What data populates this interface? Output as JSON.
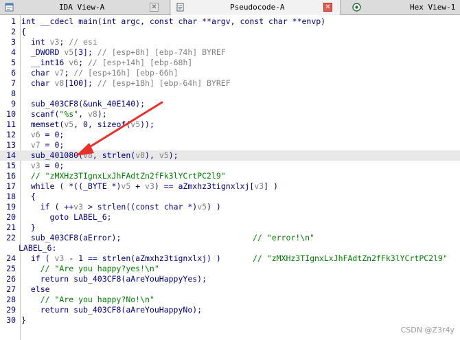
{
  "tabs": [
    {
      "label": "IDA View-A",
      "icon": "window-icon"
    },
    {
      "label": "Pseudocode-A",
      "icon": "document-icon"
    },
    {
      "label": "Hex View-1",
      "icon": "hex-icon"
    }
  ],
  "close_glyph": "✕",
  "watermark": "CSDN @Z3r4y",
  "code": [
    {
      "n": "1",
      "text": "int __cdecl main(int argc, const char **argv, const char **envp)"
    },
    {
      "n": "2",
      "text": "{"
    },
    {
      "n": "3",
      "text": "  int v3; // esi"
    },
    {
      "n": "4",
      "text": "  _DWORD v5[3]; // [esp+8h] [ebp-74h] BYREF"
    },
    {
      "n": "5",
      "text": "  __int16 v6; // [esp+14h] [ebp-68h]"
    },
    {
      "n": "6",
      "text": "  char v7; // [esp+16h] [ebp-66h]"
    },
    {
      "n": "7",
      "text": "  char v8[100]; // [esp+18h] [ebp-64h] BYREF"
    },
    {
      "n": "8",
      "text": ""
    },
    {
      "n": "9",
      "text": "  sub_403CF8(&unk_40E140);"
    },
    {
      "n": "10",
      "text": "  scanf(\"%s\", v8);"
    },
    {
      "n": "11",
      "text": "  memset(v5, 0, sizeof(v5));"
    },
    {
      "n": "12",
      "text": "  v6 = 0;"
    },
    {
      "n": "13",
      "text": "  v7 = 0;"
    },
    {
      "n": "14",
      "text": "  sub_401080(v8, strlen(v8), v5);"
    },
    {
      "n": "15",
      "text": "  v3 = 0;"
    },
    {
      "n": "16",
      "text": "  // \"zMXHz3TIgnxLxJhFAdtZn2fFk3lYCrtPC2l9\""
    },
    {
      "n": "17",
      "text": "  while ( *((_BYTE *)v5 + v3) == aZmxhz3tignxlxj[v3] )"
    },
    {
      "n": "18",
      "text": "  {"
    },
    {
      "n": "19",
      "text": "    if ( ++v3 > strlen((const char *)v5) )"
    },
    {
      "n": "20",
      "text": "      goto LABEL_6;"
    },
    {
      "n": "21",
      "text": "  }"
    },
    {
      "n": "22",
      "text": "  sub_403CF8(aError);",
      "comment": "// \"error!\\n\""
    },
    {
      "n": "",
      "text": "LABEL_6:"
    },
    {
      "n": "24",
      "text": "  if ( v3 - 1 == strlen(aZmxhz3tignxlxj) )",
      "comment": "// \"zMXHz3TIgnxLxJhFAdtZn2fFk3lYCrtPC2l9\""
    },
    {
      "n": "25",
      "text": "    // \"Are you happy?yes!\\n\""
    },
    {
      "n": "26",
      "text": "    return sub_403CF8(aAreYouHappyYes);"
    },
    {
      "n": "27",
      "text": "  else"
    },
    {
      "n": "28",
      "text": "    // \"Are you happy?No!\\n\""
    },
    {
      "n": "29",
      "text": "    return sub_403CF8(aAreYouHappyNo);"
    },
    {
      "n": "30",
      "text": "}"
    }
  ]
}
